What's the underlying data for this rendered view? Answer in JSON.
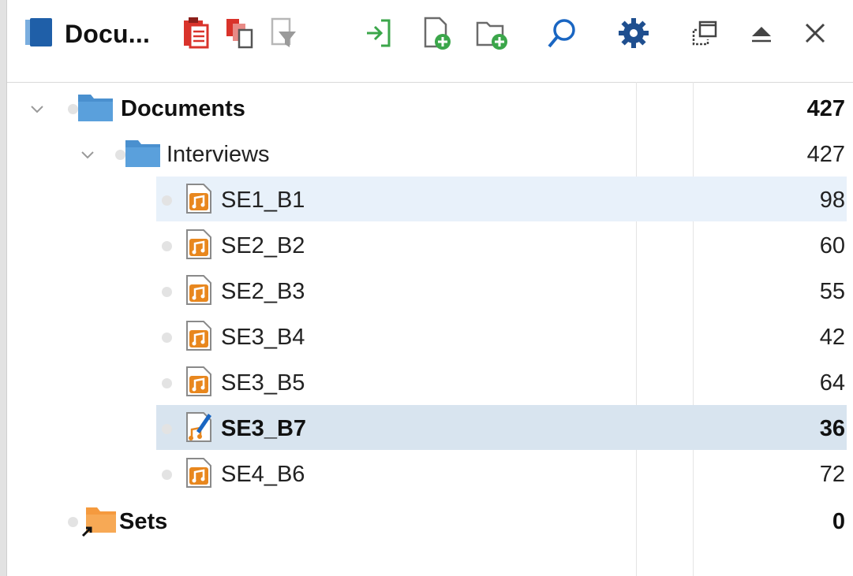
{
  "window": {
    "title": "Docu..."
  },
  "toolbar": {
    "buttons": [
      {
        "name": "paste-icon"
      },
      {
        "name": "copy-icon"
      },
      {
        "name": "filter-icon"
      },
      {
        "name": "import-icon"
      },
      {
        "name": "new-document-icon"
      },
      {
        "name": "new-folder-icon"
      },
      {
        "name": "search-icon"
      },
      {
        "name": "gear-icon"
      },
      {
        "name": "undock-window-icon"
      },
      {
        "name": "collapse-panel-icon"
      },
      {
        "name": "close-icon"
      }
    ]
  },
  "tree": {
    "documents": {
      "label": "Documents",
      "count": "427"
    },
    "interviews": {
      "label": "Interviews",
      "count": "427"
    },
    "items": [
      {
        "label": "SE1_B1",
        "count": "98"
      },
      {
        "label": "SE2_B2",
        "count": "60"
      },
      {
        "label": "SE2_B3",
        "count": "55"
      },
      {
        "label": "SE3_B4",
        "count": "42"
      },
      {
        "label": "SE3_B5",
        "count": "64"
      },
      {
        "label": "SE3_B7",
        "count": "36"
      },
      {
        "label": "SE4_B6",
        "count": "72"
      }
    ],
    "sets": {
      "label": "Sets",
      "count": "0"
    }
  },
  "colors": {
    "folder_blue": "#4a90cf",
    "folder_orange": "#f59a3e",
    "audio_orange": "#e8871e",
    "accent_red": "#d9332b",
    "accent_green": "#3ba64a",
    "accent_blue": "#1a66c2",
    "selection": "#d8e4ef",
    "hover": "#e8f1fa"
  }
}
